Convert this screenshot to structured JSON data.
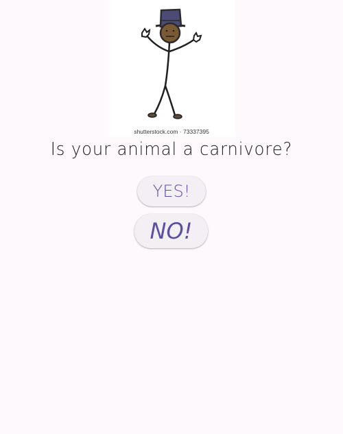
{
  "illustration": {
    "watermark": "shutterstock.com · 73337395",
    "icon": "stick-figure-top-hat-image"
  },
  "question": "Is your animal a carnivore?",
  "buttons": {
    "yes_label": "YES!",
    "no_label": "NO!"
  },
  "colors": {
    "background": "#fdf9fd",
    "button_bg": "#f3eff5",
    "button_text": "#5d4fa0",
    "question_text": "#1a1a1a"
  }
}
